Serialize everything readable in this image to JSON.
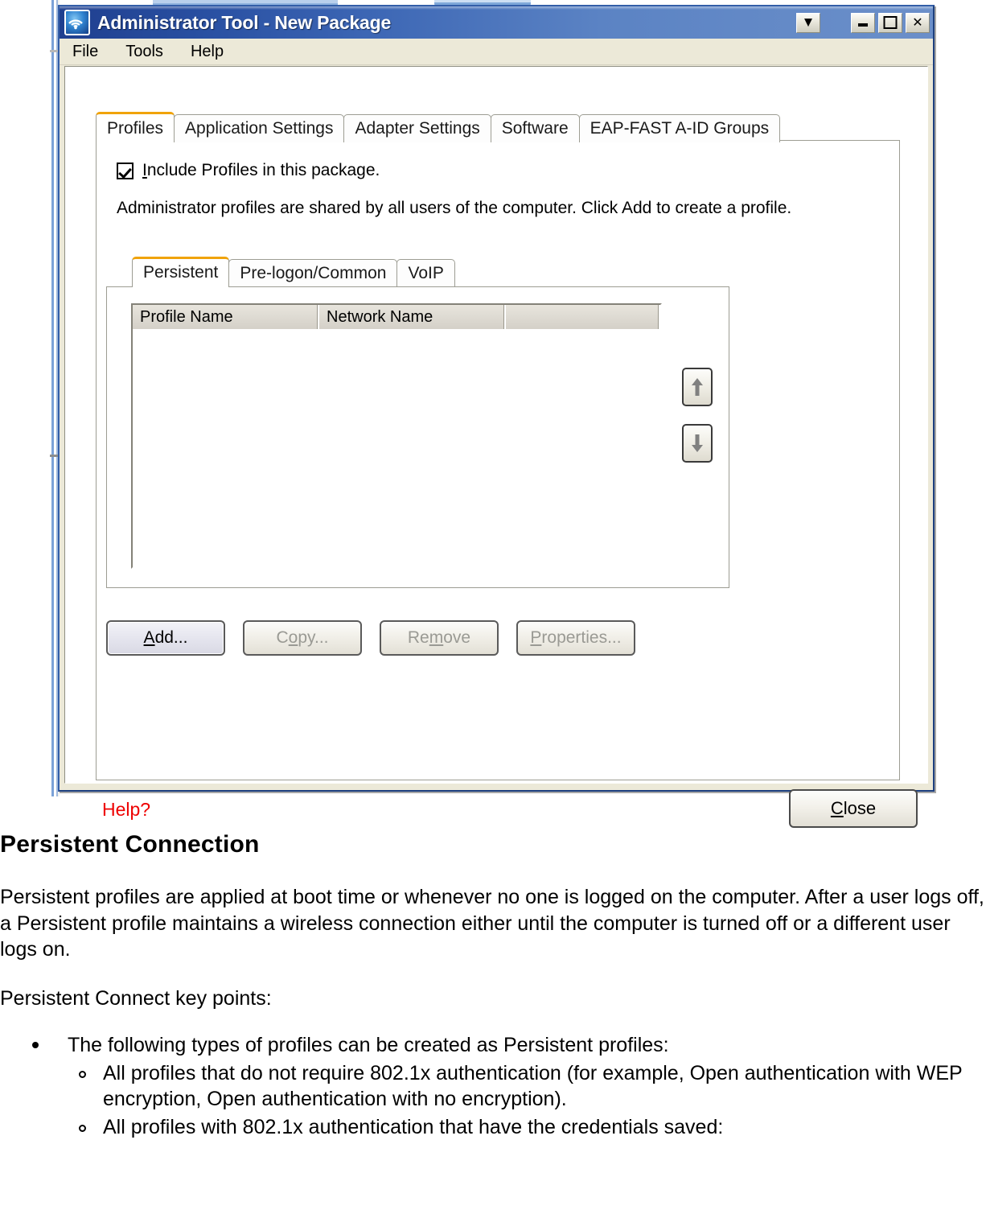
{
  "window": {
    "title": "Administrator Tool - New Package",
    "app_icon": "wireless-signal-icon",
    "controls": {
      "dropdown": "▼",
      "minimize": "_",
      "maximize": "□",
      "close": "✕"
    },
    "menus": [
      "File",
      "Tools",
      "Help"
    ]
  },
  "outer_tabs": [
    {
      "label": "Profiles",
      "active": true
    },
    {
      "label": "Application Settings",
      "active": false
    },
    {
      "label": "Adapter Settings",
      "active": false
    },
    {
      "label": "Software",
      "active": false
    },
    {
      "label": "EAP-FAST A-ID Groups",
      "active": false
    }
  ],
  "profiles_panel": {
    "include_checkbox": {
      "checked": true,
      "label_pre": "",
      "label_accel": "I",
      "label_post": "nclude Profiles in this package."
    },
    "description": "Administrator profiles are shared by all users of the computer. Click Add to create a profile.",
    "inner_tabs": [
      {
        "label": "Persistent",
        "active": true
      },
      {
        "label": "Pre-logon/Common",
        "active": false
      },
      {
        "label": "VoIP",
        "active": false
      }
    ],
    "list": {
      "columns": [
        "Profile Name",
        "Network Name",
        ""
      ],
      "rows": []
    },
    "reorder": {
      "move_up": "move-up-arrow",
      "move_down": "move-down-arrow"
    },
    "buttons": [
      {
        "pre": "",
        "accel": "A",
        "post": "dd...",
        "enabled": true,
        "focused": true,
        "name": "add-button"
      },
      {
        "pre": "C",
        "accel": "o",
        "post": "py...",
        "enabled": false,
        "focused": false,
        "name": "copy-button"
      },
      {
        "pre": "Re",
        "accel": "m",
        "post": "ove",
        "enabled": false,
        "focused": false,
        "name": "remove-button"
      },
      {
        "pre": "",
        "accel": "P",
        "post": "roperties...",
        "enabled": false,
        "focused": false,
        "name": "properties-button"
      }
    ]
  },
  "footer": {
    "help_link": "Help?",
    "help_color": "#ee0000",
    "close": {
      "pre": "",
      "accel": "C",
      "post": "lose"
    }
  },
  "article": {
    "heading": "Persistent Connection",
    "paragraph1": "Persistent profiles are applied at boot time or whenever no one is logged on the computer. After a user logs off, a Persistent profile maintains a wireless connection either until the computer is turned off or a different user logs on.",
    "paragraph2": "Persistent Connect key points:",
    "bullet1": "The following types of profiles can be created as Persistent profiles:",
    "sub1": "All profiles that do not require 802.1x authentication (for example, Open authentication with WEP encryption, Open authentication with no encryption).",
    "sub2": "All profiles with 802.1x authentication that have the credentials saved:"
  },
  "colors": {
    "title_bar_start": "#1f3f8f",
    "title_bar_end": "#6b8fc9",
    "active_tab_accent": "#f0a30a",
    "window_face": "#ece9d8",
    "list_header": "#d4d0c8"
  }
}
